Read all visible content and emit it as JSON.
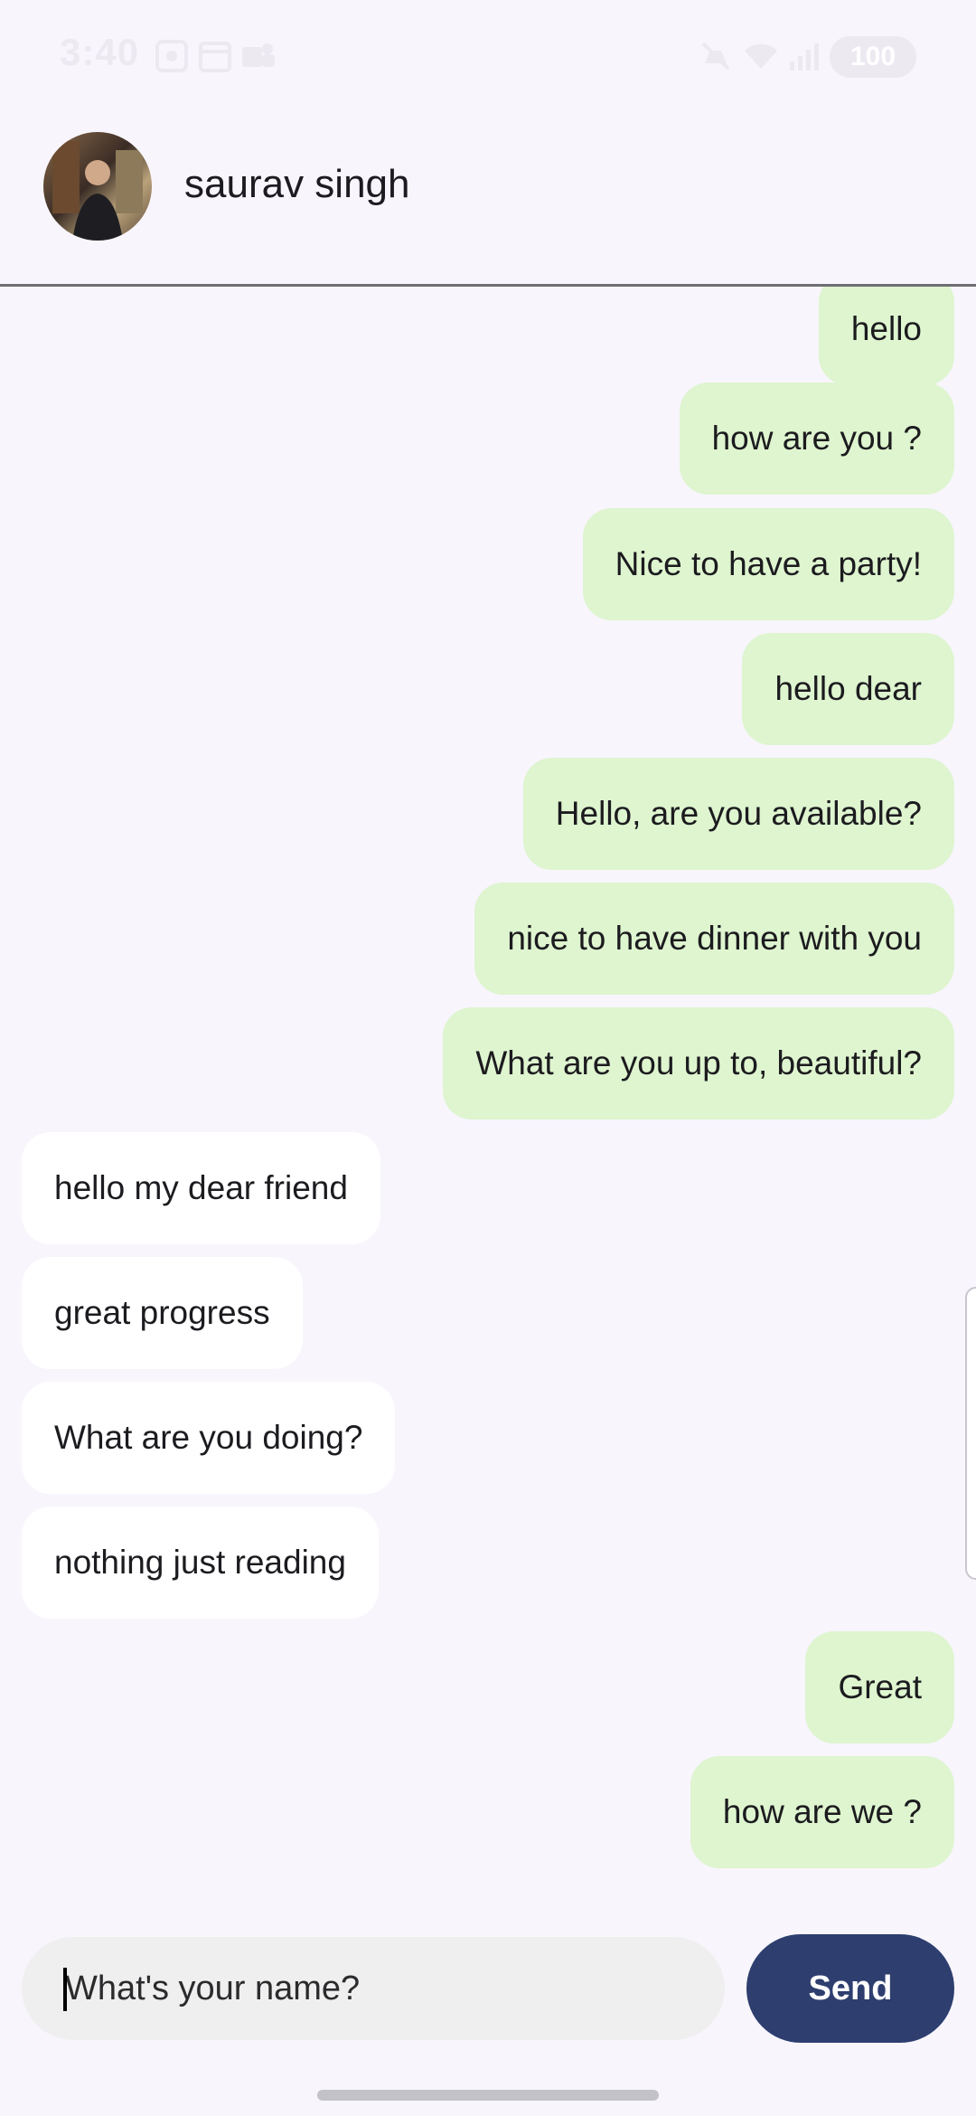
{
  "status_bar": {
    "time": "3:40",
    "battery": "100"
  },
  "contact": {
    "name": "saurav singh"
  },
  "messages": [
    {
      "text": "hello",
      "from": "me"
    },
    {
      "text": "how are you ?",
      "from": "me"
    },
    {
      "text": "Nice to have a party!",
      "from": "me"
    },
    {
      "text": "hello dear",
      "from": "me"
    },
    {
      "text": "Hello, are you available?",
      "from": "me"
    },
    {
      "text": "nice to have dinner with you",
      "from": "me"
    },
    {
      "text": "What are you up to, beautiful?",
      "from": "me"
    },
    {
      "text": "hello my dear friend",
      "from": "them"
    },
    {
      "text": "great progress",
      "from": "them"
    },
    {
      "text": "What are you doing?",
      "from": "them"
    },
    {
      "text": "nothing just reading",
      "from": "them"
    },
    {
      "text": "Great",
      "from": "me"
    },
    {
      "text": "how are we ?",
      "from": "me"
    }
  ],
  "composer": {
    "placeholder": "What's your name?",
    "send_label": "Send"
  },
  "colors": {
    "sent_bubble": "#def5cf",
    "received_bubble": "#ffffff",
    "send_button": "#2d3e6f",
    "background": "#f8f5fc"
  }
}
